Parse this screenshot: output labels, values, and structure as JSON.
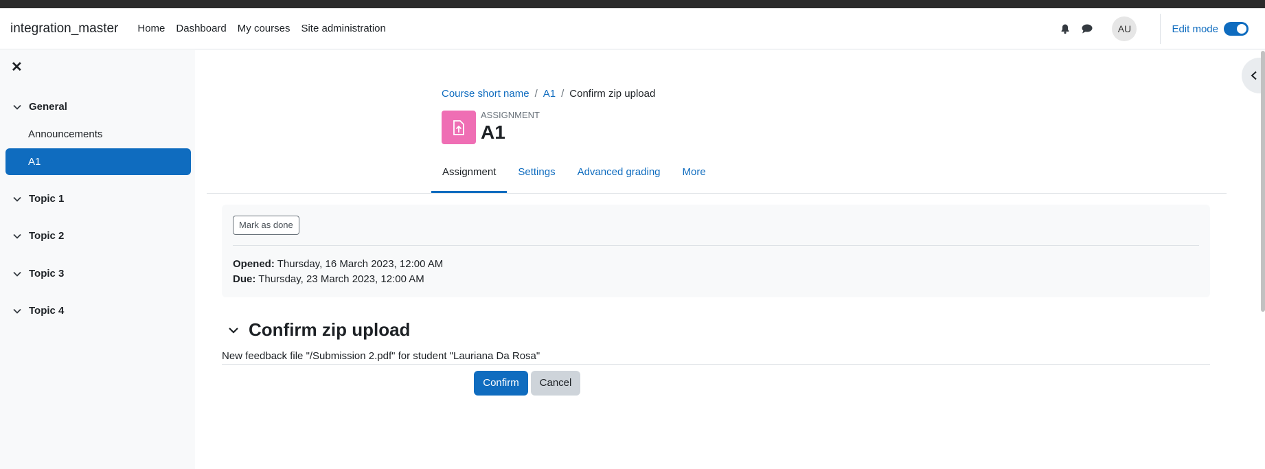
{
  "site": {
    "name": "integration_master"
  },
  "primary_nav": [
    "Home",
    "Dashboard",
    "My courses",
    "Site administration"
  ],
  "user": {
    "initials": "AU"
  },
  "edit_mode": {
    "label": "Edit mode",
    "on": true
  },
  "course_index": {
    "sections": [
      {
        "label": "General",
        "activities": [
          "Announcements",
          "A1"
        ],
        "active_activity": "A1"
      },
      {
        "label": "Topic 1"
      },
      {
        "label": "Topic 2"
      },
      {
        "label": "Topic 3"
      },
      {
        "label": "Topic 4"
      }
    ]
  },
  "breadcrumb": [
    "Course short name",
    "A1",
    "Confirm zip upload"
  ],
  "activity": {
    "type": "ASSIGNMENT",
    "title": "A1",
    "icon_color": "#ef6eb4"
  },
  "tabs": [
    {
      "label": "Assignment",
      "active": true
    },
    {
      "label": "Settings"
    },
    {
      "label": "Advanced grading"
    },
    {
      "label": "More"
    }
  ],
  "activity_info": {
    "mark_done_label": "Mark as done",
    "opened_label": "Opened:",
    "opened_value": "Thursday, 16 March 2023, 12:00 AM",
    "due_label": "Due:",
    "due_value": "Thursday, 23 March 2023, 12:00 AM"
  },
  "confirm": {
    "heading": "Confirm zip upload",
    "message": "New feedback file \"/Submission 2.pdf\" for student \"Lauriana Da Rosa\"",
    "confirm_label": "Confirm",
    "cancel_label": "Cancel"
  },
  "colors": {
    "primary": "#0f6cbf",
    "drawer_bg": "#f8f9fa",
    "assignment_icon": "#ef6eb4"
  }
}
